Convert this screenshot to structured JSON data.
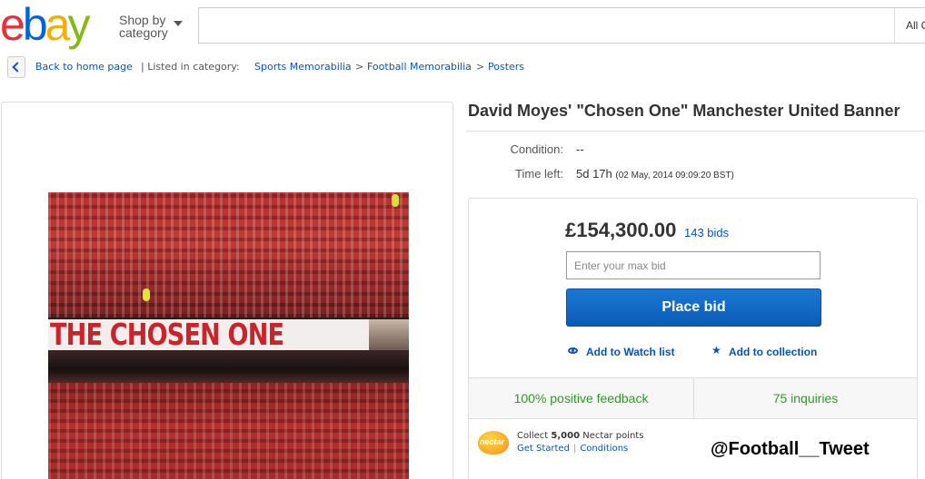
{
  "header": {
    "logo_text": "ebay",
    "shop_by_line1": "Shop by",
    "shop_by_line2": "category",
    "search_value": "",
    "search_category": "All C"
  },
  "breadcrumb": {
    "back_label": "Back to home page",
    "listed_in": "| Listed in category:",
    "items": [
      "Sports Memorabilia",
      "Football Memorabilia",
      "Posters"
    ],
    "separator": ">"
  },
  "image": {
    "banner_text": "THE CHOSEN ONE"
  },
  "item": {
    "title": "David Moyes' \"Chosen One\" Manchester United Banner",
    "condition_label": "Condition:",
    "condition_value": "--",
    "time_left_label": "Time left:",
    "time_left_value": "5d 17h",
    "time_left_end": "(02 May, 2014   09:09:20 BST)"
  },
  "bid": {
    "price": "£154,300.00",
    "bids": "143 bids",
    "max_bid_placeholder": "Enter your max bid",
    "place_bid_label": "Place bid",
    "watch_label": "Add to Watch list",
    "collection_label": "Add to collection"
  },
  "stats": {
    "feedback": "100% positive feedback",
    "inquiries": "75 inquiries"
  },
  "nectar": {
    "logo_text": "nectar",
    "collect_prefix": "Collect",
    "collect_points": "5,000",
    "collect_suffix": "Nectar points",
    "get_started": "Get Started",
    "divider": "|",
    "conditions": "Conditions"
  },
  "watermark": "@Football__Tweet",
  "colors": {
    "link": "#0654ba",
    "feedback_green": "#2a9d1f",
    "bid_button": "#0a5cb5",
    "ebay_red": "#e53238",
    "ebay_blue": "#0064d2",
    "ebay_yellow": "#f5af02",
    "ebay_green": "#86b817"
  }
}
